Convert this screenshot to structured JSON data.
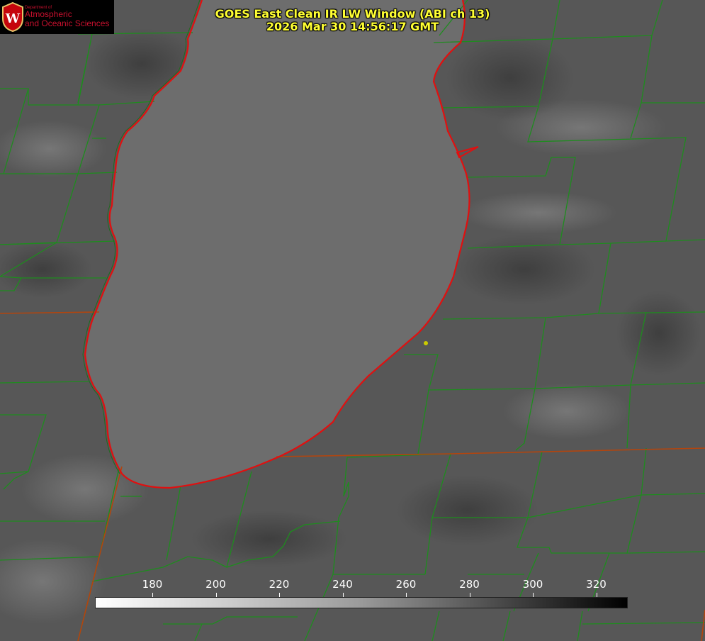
{
  "header": {
    "title_line1": "GOES East Clean IR LW Window (ABI ch 13)",
    "title_line2": "2026 Mar 30 14:56:17 GMT"
  },
  "logo": {
    "dept": "Department of",
    "line1": "Atmospheric",
    "line2": "and Oceanic Sciences",
    "seal_letter": "W"
  },
  "colorbar": {
    "ticks": [
      "180",
      "200",
      "220",
      "240",
      "260",
      "280",
      "300",
      "320"
    ]
  },
  "colors": {
    "title": "#ffff33",
    "borders": "#1e8c1e",
    "coast": "#e01010"
  }
}
